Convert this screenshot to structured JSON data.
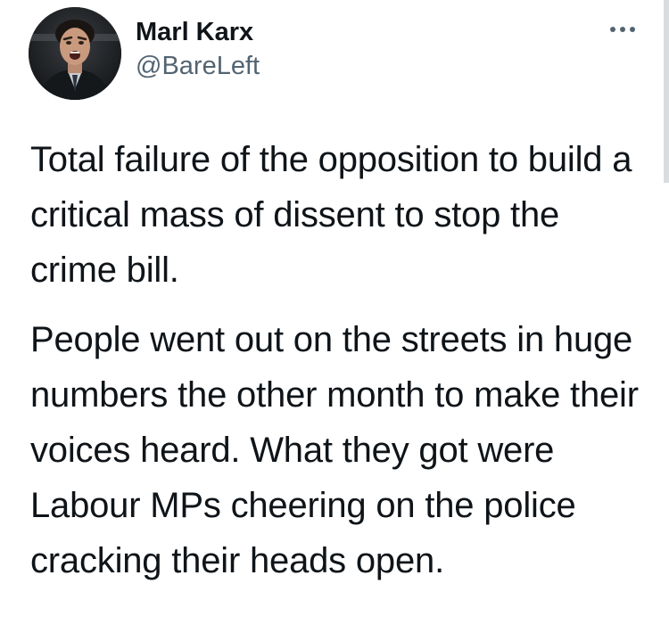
{
  "tweet": {
    "author": {
      "display_name": "Marl Karx",
      "handle": "@BareLeft"
    },
    "more_icon": "more-horizontal-icon",
    "paragraphs": [
      "Total failure of the opposition to build a critical mass of dissent to stop the crime bill.",
      "People went out on the streets in huge numbers the other month to make their voices heard. What they got were Labour MPs cheering on the police cracking their heads open."
    ]
  },
  "colors": {
    "text": "#0f1419",
    "secondary_text": "#536471",
    "background": "#ffffff"
  }
}
